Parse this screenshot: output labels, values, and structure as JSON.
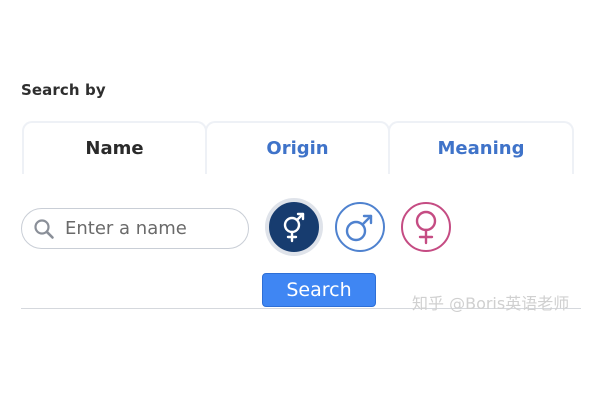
{
  "search_by": {
    "label": "Search by"
  },
  "tabs": [
    {
      "label": "Name",
      "active": true
    },
    {
      "label": "Origin",
      "active": false
    },
    {
      "label": "Meaning",
      "active": false
    }
  ],
  "search": {
    "placeholder": "Enter a name",
    "value": ""
  },
  "genders": [
    {
      "icon": "unisex-symbol-icon",
      "selected": true,
      "color": "#173c6f"
    },
    {
      "icon": "male-symbol-icon",
      "selected": false,
      "color": "#4f82cf"
    },
    {
      "icon": "female-symbol-icon",
      "selected": false,
      "color": "#c54c83"
    }
  ],
  "search_button": {
    "label": "Search",
    "color": "#3f86f3"
  },
  "watermark": {
    "text": "知乎 @Boris英语老师"
  }
}
